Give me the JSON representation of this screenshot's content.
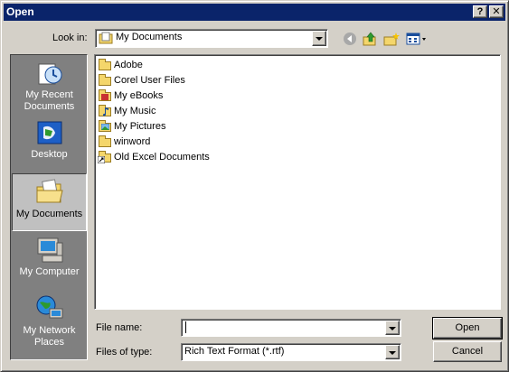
{
  "window": {
    "title": "Open",
    "help_label": "?",
    "close_label": "✕"
  },
  "toolbar": {
    "look_in_label": "Look in:",
    "look_in_value": "My Documents",
    "back_icon": "back-arrow-icon",
    "up_icon": "up-folder-icon",
    "new_folder_icon": "new-folder-icon",
    "views_icon": "views-menu-icon"
  },
  "places": [
    {
      "label": "My Recent Documents",
      "icon": "recent-documents-icon"
    },
    {
      "label": "Desktop",
      "icon": "desktop-icon"
    },
    {
      "label": "My Documents",
      "icon": "my-documents-icon",
      "selected": true
    },
    {
      "label": "My Computer",
      "icon": "my-computer-icon"
    },
    {
      "label": "My Network Places",
      "icon": "network-places-icon"
    }
  ],
  "files": [
    {
      "name": "Adobe",
      "icon": "folder-icon"
    },
    {
      "name": "Corel User Files",
      "icon": "folder-icon"
    },
    {
      "name": "My eBooks",
      "icon": "ebooks-folder-icon"
    },
    {
      "name": "My Music",
      "icon": "music-folder-icon"
    },
    {
      "name": "My Pictures",
      "icon": "pictures-folder-icon"
    },
    {
      "name": "winword",
      "icon": "folder-icon"
    },
    {
      "name": "Old Excel Documents",
      "icon": "shortcut-icon"
    }
  ],
  "form": {
    "file_name_label": "File name:",
    "file_name_value": "",
    "files_of_type_label": "Files of type:",
    "files_of_type_value": "Rich Text Format (*.rtf)"
  },
  "buttons": {
    "open_label": "Open",
    "cancel_label": "Cancel"
  },
  "colors": {
    "title_bar": "#0a246a",
    "dialog_bg": "#d4d0c8",
    "places_bar": "#808080",
    "folder": "#f4d66b"
  }
}
